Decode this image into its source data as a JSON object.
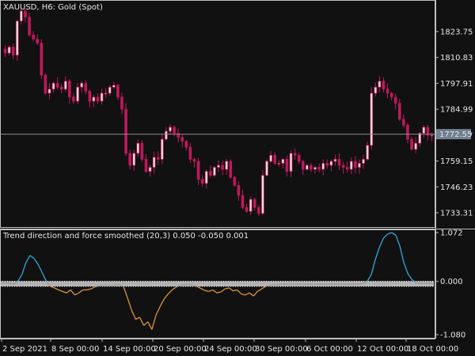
{
  "main_title": "XAUUSD, H6:  Gold (Spot)",
  "indicator_title": "Trend direction and force smoothed (20,3) 0.050 -0.050 0.001",
  "current_price": "1772.55",
  "colors": {
    "background": "#111111",
    "candle": "#c2185b",
    "candle_up_body": "#f2d7d9",
    "grid_line": "#8c8c8c",
    "price_tag_bg": "#708090",
    "indicator_up": "#2eaadc",
    "indicator_down": "#e0953a",
    "indicator_neutral": "#9a9a9a",
    "level_band": "#cfcfcf"
  },
  "chart_data": [
    {
      "type": "candlestick",
      "symbol": "XAUUSD",
      "timeframe": "H6",
      "y_axis_ticks": [
        "1823.75",
        "1810.83",
        "1797.91",
        "1784.99",
        "1772.07",
        "1759.15",
        "1746.23",
        "1733.31"
      ],
      "ylim": [
        1725.8,
        1839.5
      ],
      "current_price": 1772.55,
      "x_tick_labels": [
        "2 Sep 2021",
        "8 Sep 00:00",
        "14 Sep 00:00",
        "20 Sep 00:00",
        "24 Sep 00:00",
        "30 Sep 00:00",
        "6 Oct 00:00",
        "12 Oct 00:00",
        "18 Oct 00:00"
      ],
      "close": [
        1813,
        1816,
        1812,
        1829,
        1834,
        1831,
        1822,
        1820,
        1818,
        1802,
        1793,
        1795,
        1798,
        1796,
        1795,
        1799,
        1791,
        1789,
        1796,
        1798,
        1794,
        1789,
        1791,
        1789,
        1793,
        1793,
        1796,
        1797,
        1791,
        1785,
        1763,
        1757,
        1763,
        1768,
        1760,
        1754,
        1756,
        1761,
        1760,
        1770,
        1774,
        1776,
        1773,
        1771,
        1769,
        1766,
        1760,
        1759,
        1750,
        1748,
        1754,
        1752,
        1756,
        1757,
        1755,
        1759,
        1751,
        1747,
        1742,
        1736,
        1734,
        1740,
        1736,
        1733,
        1752,
        1759,
        1762,
        1758,
        1758,
        1760,
        1754,
        1763,
        1762,
        1759,
        1755,
        1757,
        1755,
        1756,
        1755,
        1758,
        1757,
        1759,
        1760,
        1757,
        1756,
        1755,
        1759,
        1756,
        1758,
        1760,
        1767,
        1793,
        1796,
        1799,
        1795,
        1793,
        1791,
        1788,
        1780,
        1777,
        1770,
        1765,
        1768,
        1773,
        1776,
        1772,
        1772
      ]
    },
    {
      "type": "line",
      "name": "Trend direction and force smoothed (20,3)",
      "y_axis_ticks": [
        "1.072",
        "0.000",
        "-1.080"
      ],
      "ylim": [
        -1.08,
        1.072
      ],
      "levels": [
        0.05,
        -0.05
      ],
      "values": [
        0.02,
        0.03,
        0.01,
        -0.01,
        0.05,
        0.18,
        0.42,
        0.56,
        0.5,
        0.38,
        0.22,
        0.05,
        -0.05,
        -0.08,
        -0.12,
        -0.15,
        -0.18,
        -0.12,
        -0.22,
        -0.18,
        -0.12,
        -0.12,
        -0.1,
        -0.06,
        -0.04,
        -0.03,
        -0.03,
        -0.04,
        -0.03,
        -0.02,
        -0.05,
        -0.28,
        -0.52,
        -0.7,
        -0.66,
        -0.82,
        -0.75,
        -0.9,
        -0.62,
        -0.45,
        -0.3,
        -0.2,
        -0.12,
        -0.06,
        -0.03,
        -0.02,
        -0.01,
        -0.03,
        -0.05,
        -0.09,
        -0.13,
        -0.15,
        -0.12,
        -0.18,
        -0.16,
        -0.1,
        -0.08,
        -0.14,
        -0.12,
        -0.2,
        -0.22,
        -0.18,
        -0.24,
        -0.15,
        -0.1,
        -0.05,
        -0.03,
        -0.02,
        -0.02,
        -0.01,
        -0.01,
        -0.01,
        -0.01,
        -0.01,
        -0.01,
        -0.01,
        -0.01,
        -0.01,
        -0.01,
        -0.01,
        -0.01,
        -0.01,
        -0.01,
        -0.01,
        -0.01,
        -0.01,
        -0.01,
        -0.01,
        -0.01,
        0.01,
        0.05,
        0.18,
        0.48,
        0.72,
        0.9,
        0.98,
        1.01,
        0.96,
        0.75,
        0.42,
        0.2,
        0.08,
        0.03,
        0.01,
        0.01,
        0.01,
        0.01
      ]
    }
  ]
}
